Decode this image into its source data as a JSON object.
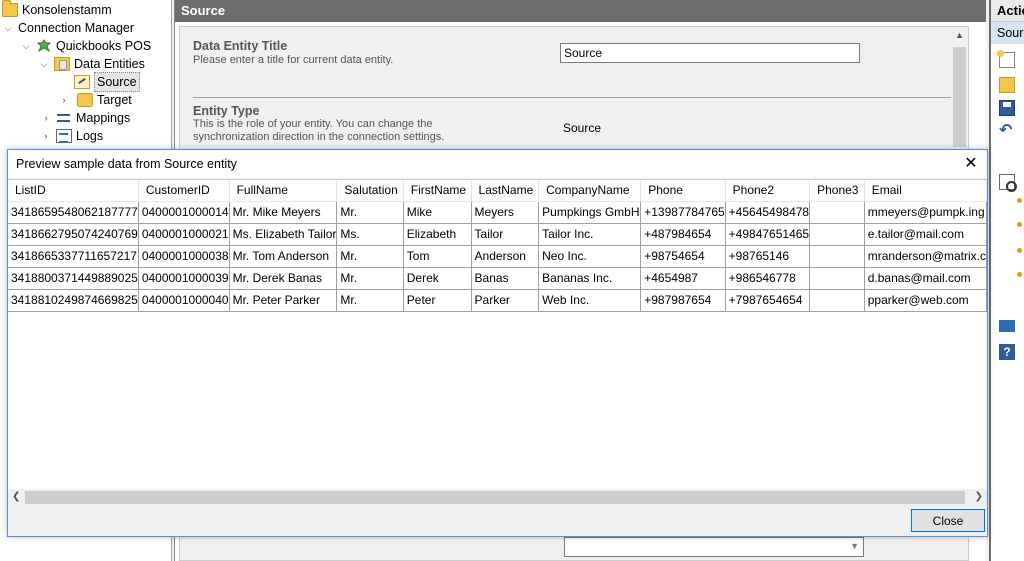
{
  "tree": {
    "items": [
      {
        "label": "Konsolenstamm",
        "icon": "folder-icon",
        "expand": ""
      },
      {
        "label": "Connection Manager",
        "icon": "",
        "expand": "v"
      },
      {
        "label": "Quickbooks POS",
        "icon": "plug-icon",
        "expand": "v"
      },
      {
        "label": "Data Entities",
        "icon": "entities-icon",
        "expand": "v"
      },
      {
        "label": "Source",
        "icon": "source-entity-icon",
        "expand": "",
        "selected": true
      },
      {
        "label": "Target",
        "icon": "target-entity-icon",
        "expand": ">"
      },
      {
        "label": "Mappings",
        "icon": "mappings-icon",
        "expand": ">"
      },
      {
        "label": "Logs",
        "icon": "logs-icon",
        "expand": ">"
      }
    ]
  },
  "center": {
    "header": "Source",
    "data_entity_title": {
      "label": "Data Entity Title",
      "desc": "Please enter a title for current data entity.",
      "value": "Source"
    },
    "entity_type": {
      "label": "Entity Type",
      "desc_line1": "This is the role of your entity. You can change the",
      "desc_line2": "synchronization direction in the connection settings.",
      "value": "Source"
    }
  },
  "actions": {
    "header": "Actions",
    "sub": "Source"
  },
  "dialog": {
    "title": "Preview sample data from Source entity",
    "close_label": "Close",
    "columns": [
      "ListID",
      "CustomerID",
      "FullName",
      "Salutation",
      "FirstName",
      "LastName",
      "CompanyName",
      "Phone",
      "Phone2",
      "Phone3",
      "Email"
    ],
    "rows": [
      [
        "3418659548062187777",
        "0400001000014",
        "Mr. Mike Meyers",
        "Mr.",
        "Mike",
        "Meyers",
        "Pumpkings GmbH",
        "+13987784765",
        "+45645498478",
        "",
        "mmeyers@pumpk.ing"
      ],
      [
        "3418662795074240769",
        "0400001000021",
        "Ms. Elizabeth Tailor",
        "Ms.",
        "Elizabeth",
        "Tailor",
        "Tailor Inc.",
        "+487984654",
        "+49847651465",
        "",
        "e.tailor@mail.com"
      ],
      [
        "3418665337711657217",
        "0400001000038",
        "Mr. Tom Anderson",
        "Mr.",
        "Tom",
        "Anderson",
        "Neo Inc.",
        "+98754654",
        "+98765146",
        "",
        "mranderson@matrix.c"
      ],
      [
        "3418800371449889025",
        "0400001000039",
        "Mr. Derek Banas",
        "Mr.",
        "Derek",
        "Banas",
        "Bananas Inc.",
        "+4654987",
        "+986546778",
        "",
        "d.banas@mail.com"
      ],
      [
        "3418810249874669825",
        "0400001000040",
        "Mr. Peter Parker",
        "Mr.",
        "Peter",
        "Parker",
        "Web Inc.",
        "+987987654",
        "+7987654654",
        "",
        "pparker@web.com"
      ]
    ]
  }
}
